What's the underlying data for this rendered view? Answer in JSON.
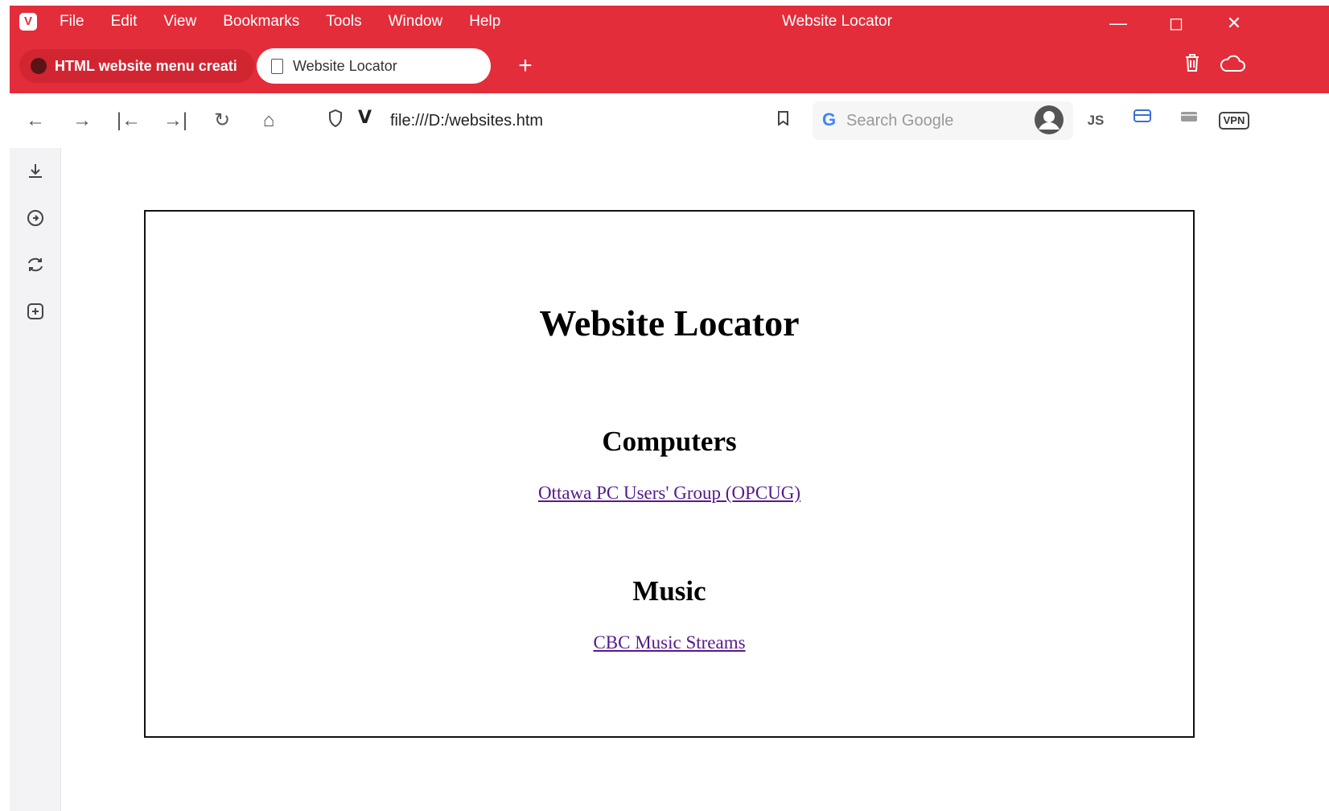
{
  "window": {
    "title": "Website Locator",
    "accent_color": "#e32d3a",
    "controls": {
      "minimize_icon": "minimize-icon",
      "maximize_icon": "maximize-icon",
      "close_icon": "close-icon"
    }
  },
  "menu": {
    "items": [
      "File",
      "Edit",
      "View",
      "Bookmarks",
      "Tools",
      "Window",
      "Help"
    ]
  },
  "tabs": [
    {
      "label": "HTML website menu creati",
      "active": false,
      "icon": "site-favicon"
    },
    {
      "label": "Website Locator",
      "active": true,
      "icon": "document-icon"
    }
  ],
  "toolbar": {
    "url": "file:///D:/websites.htm",
    "search_placeholder": "Search Google",
    "js_label": "JS",
    "vpn_label": "VPN"
  },
  "page": {
    "title": "Website Locator",
    "sections": [
      {
        "heading": "Computers",
        "link_text": "Ottawa PC Users' Group (OPCUG)"
      },
      {
        "heading": "Music",
        "link_text": "CBC Music Streams"
      }
    ],
    "link_color": "#551a8b"
  }
}
